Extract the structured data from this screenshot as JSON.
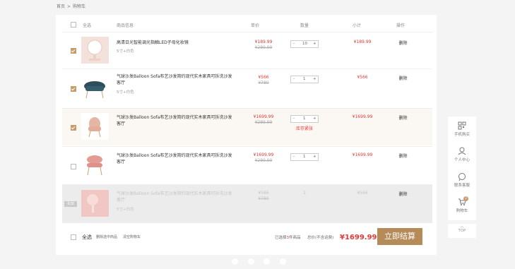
{
  "breadcrumb": {
    "home": "首页",
    "sep": ">",
    "current": "购物车"
  },
  "header": {
    "select_all": "全选",
    "info": "商品信息",
    "price": "单价",
    "qty": "数量",
    "subtotal": "小计",
    "action": "操作"
  },
  "items": [
    {
      "name": "高清日光智能调光指触LED子母化妆镜",
      "spec": "5寸+白色",
      "price": "¥189.99",
      "old_price": "¥289.99",
      "qty": "10",
      "qty_minus": "-",
      "qty_plus": "+",
      "subtotal": "¥189.99",
      "action": "删除",
      "checked": true
    },
    {
      "name": "气球沙发Balloon Sofa布艺沙发简约现代实木家具可拆洗沙发客厅",
      "spec": "5寸+白色",
      "price": "¥566",
      "old_price": "¥780",
      "qty": "1",
      "qty_minus": "-",
      "qty_plus": "+",
      "subtotal": "¥566",
      "action": "删除",
      "checked": true
    },
    {
      "name": "气球沙发Balloon Sofa布艺沙发简约现代实木家具可拆洗沙发客厅",
      "price": "¥1699.99",
      "old_price": "¥289.99",
      "qty": "1",
      "qty_minus": "-",
      "qty_plus": "+",
      "stock_warning": "库存紧张",
      "subtotal": "¥1699.99",
      "action": "删除",
      "checked": true
    },
    {
      "name": "气球沙发Balloon Sofa布艺沙发简约现代实木家具可拆洗沙发客厅",
      "price": "¥1699.99",
      "old_price": "¥289.99",
      "qty": "1",
      "qty_minus": "-",
      "qty_plus": "+",
      "subtotal": "¥1699.99",
      "action": "删除",
      "checked": false
    },
    {
      "badge": "失效",
      "name": "气球沙发Balloon Sofa布艺沙发简约现代实木家具可拆洗沙发客厅",
      "spec": "5寸+白色",
      "price": "¥566",
      "old_price": "¥780",
      "qty": "1",
      "subtotal": "¥566",
      "action": "删除"
    }
  ],
  "footer": {
    "select_all": "全选",
    "delete_selected": "删除选中商品",
    "clear_cart": "清空购物车",
    "selected_count_pre": "已选择",
    "selected_count": "3",
    "selected_count_post": "件商品",
    "total_label": "总价(不含运费)",
    "total": "¥1699.99",
    "checkout": "立即结算"
  },
  "sidebar": {
    "mobile": "手机购买",
    "personal": "个人中心",
    "service": "联系客服",
    "cart": "购物车",
    "cart_count": "2",
    "top": "TOP"
  },
  "colors": {
    "accent": "#b58b5a",
    "price": "#e23a3a"
  }
}
